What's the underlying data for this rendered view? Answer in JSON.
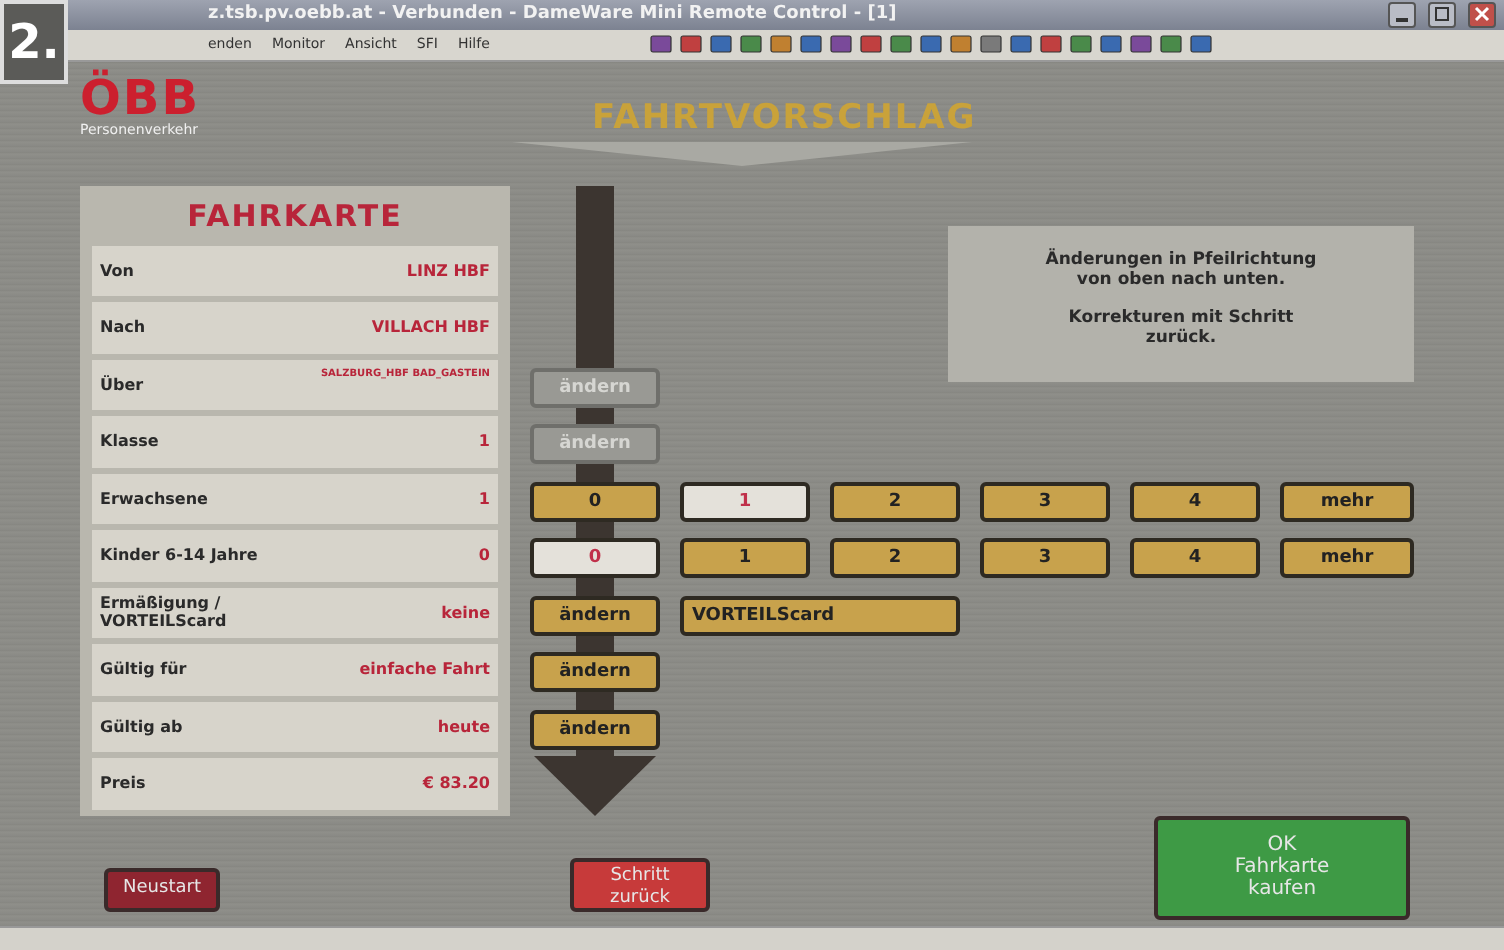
{
  "badge": "2.",
  "window": {
    "title": "z.tsb.pv.oebb.at - Verbunden - DameWare Mini Remote Control - [1]"
  },
  "menu": [
    "enden",
    "Monitor",
    "Ansicht",
    "SFI",
    "Hilfe"
  ],
  "brand": {
    "logo": "ÖBB",
    "tagline": "Personenverkehr"
  },
  "page_title": "FAHRTVORSCHLAG",
  "ticket": {
    "title": "FAHRKARTE",
    "rows": [
      {
        "label": "Von",
        "value": "LINZ HBF"
      },
      {
        "label": "Nach",
        "value": "VILLACH HBF"
      },
      {
        "label": "Über",
        "value": "SALZBURG_HBF BAD_GASTEIN",
        "controls": [
          {
            "kind": "change",
            "label": "ändern",
            "disabled": true
          }
        ]
      },
      {
        "label": "Klasse",
        "value": "1",
        "controls": [
          {
            "kind": "change",
            "label": "ändern",
            "disabled": true
          }
        ]
      },
      {
        "label": "Erwachsene",
        "value": "1",
        "controls": [
          {
            "kind": "option",
            "label": "0",
            "selected": false
          },
          {
            "kind": "option",
            "label": "1",
            "selected": true
          },
          {
            "kind": "option",
            "label": "2",
            "selected": false
          },
          {
            "kind": "option",
            "label": "3",
            "selected": false
          },
          {
            "kind": "option",
            "label": "4",
            "selected": false
          },
          {
            "kind": "option",
            "label": "mehr",
            "selected": false
          }
        ]
      },
      {
        "label": "Kinder 6-14 Jahre",
        "value": "0",
        "controls": [
          {
            "kind": "option",
            "label": "0",
            "selected": true
          },
          {
            "kind": "option",
            "label": "1",
            "selected": false
          },
          {
            "kind": "option",
            "label": "2",
            "selected": false
          },
          {
            "kind": "option",
            "label": "3",
            "selected": false
          },
          {
            "kind": "option",
            "label": "4",
            "selected": false
          },
          {
            "kind": "option",
            "label": "mehr",
            "selected": false
          }
        ]
      },
      {
        "label": "Ermäßigung / VORTEILScard",
        "value": "keine",
        "controls": [
          {
            "kind": "change",
            "label": "ändern",
            "disabled": false
          },
          {
            "kind": "card",
            "label": "VORTEILScard"
          }
        ]
      },
      {
        "label": "Gültig für",
        "value": "einfache Fahrt",
        "controls": [
          {
            "kind": "change",
            "label": "ändern",
            "disabled": false
          }
        ]
      },
      {
        "label": "Gültig ab",
        "value": "heute",
        "controls": [
          {
            "kind": "change",
            "label": "ändern",
            "disabled": false
          }
        ]
      },
      {
        "label": "Preis",
        "value": "€ 83.20"
      }
    ]
  },
  "info": [
    "Änderungen in Pfeilrichtung von oben nach unten.",
    "Korrekturen mit Schritt zurück."
  ],
  "buttons": [
    {
      "kind": "restart",
      "label": "Neustart"
    },
    {
      "kind": "back",
      "label": "Schritt zurück"
    },
    {
      "kind": "buy",
      "label": "OK Fahrkarte kaufen"
    }
  ]
}
